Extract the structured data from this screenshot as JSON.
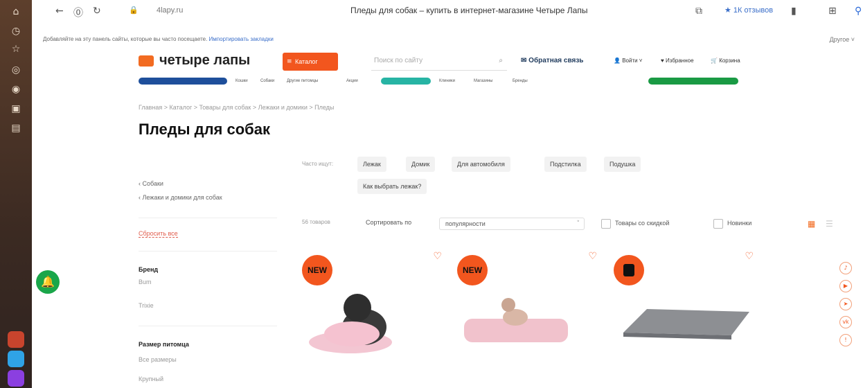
{
  "browser": {
    "url": "4lapy.ru",
    "title": "Пледы для собак – купить в интернет-магазине Четыре Лапы",
    "reviews": "★ 1К отзывов",
    "bookmark_hint": "Добавляйте на эту панель сайты, которые вы часто посещаете.",
    "bookmark_link": "Импортировать закладки",
    "bookmark_other": "Другое"
  },
  "header": {
    "logo": "четыре лапы",
    "catalog": "Каталог",
    "search_placeholder": "Поиск по сайту",
    "feedback": "Обратная связь",
    "login": "Войти",
    "favorites": "Избранное",
    "cart": "Корзина",
    "nav": [
      "Кошки",
      "Собаки",
      "Другие питомцы",
      "Акции",
      "Клиники",
      "Магазины",
      "Бренды"
    ]
  },
  "breadcrumb": "Главная  >  Каталог  >  Товары для собак  >  Лежаки и домики  >  Пледы",
  "page_title": "Пледы для собак",
  "sidebar": {
    "back1": "Собаки",
    "back2": "Лежаки и домики для собак",
    "reset": "Сбросить все",
    "brand_title": "Бренд",
    "brands": [
      "Bum",
      "Trixie"
    ],
    "size_title": "Размер питомца",
    "sizes": [
      "Все размеры",
      "Крупный"
    ]
  },
  "chips": {
    "label": "Часто ищут:",
    "items": [
      "Лежак",
      "Домик",
      "Для автомобиля",
      "Подстилка",
      "Подушка",
      "Как выбрать лежак?"
    ]
  },
  "sort": {
    "count": "56 товаров",
    "label": "Сортировать по",
    "value": "популярности",
    "discount": "Товары со скидкой",
    "new": "Новинки"
  },
  "cards": [
    {
      "badge": "NEW"
    },
    {
      "badge": "NEW"
    },
    {
      "badge": ""
    }
  ],
  "colors": {
    "accent": "#f2561e",
    "green": "#1aa64a"
  }
}
